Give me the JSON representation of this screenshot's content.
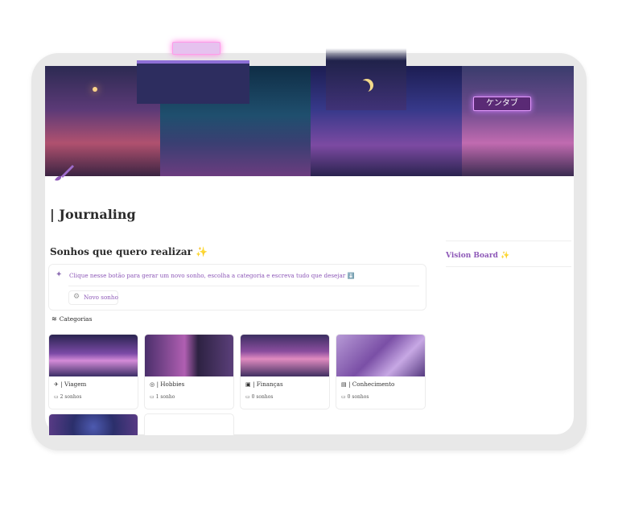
{
  "page": {
    "title": "| Journaling"
  },
  "cover": {
    "sign_text": "ケンタブ"
  },
  "section": {
    "title": "Sonhos que quero realizar",
    "sparkle": "✨"
  },
  "callout": {
    "text": "Clique nesse botão para gerar um novo sonho, escolha a categoria e escreva tudo que desejar",
    "arrow": "⬇️",
    "button_label": "Novo sonho"
  },
  "categories": {
    "header": "Categorias",
    "cards": [
      {
        "name": "| Viagem",
        "count": "2 sonhos",
        "icon": "airplane-icon"
      },
      {
        "name": "| Hobbies",
        "count": "1 sonho",
        "icon": "palette-icon"
      },
      {
        "name": "| Finanças",
        "count": "0 sonhos",
        "icon": "wallet-icon"
      },
      {
        "name": "| Conhecimento",
        "count": "0 sonhos",
        "icon": "book-icon"
      }
    ]
  },
  "sidebar": {
    "vision_board": "Vision Board",
    "sparkle": "✨"
  },
  "colors": {
    "accent": "#8e59b8",
    "text": "#2b2b2b",
    "frame": "#e8e8e8"
  }
}
